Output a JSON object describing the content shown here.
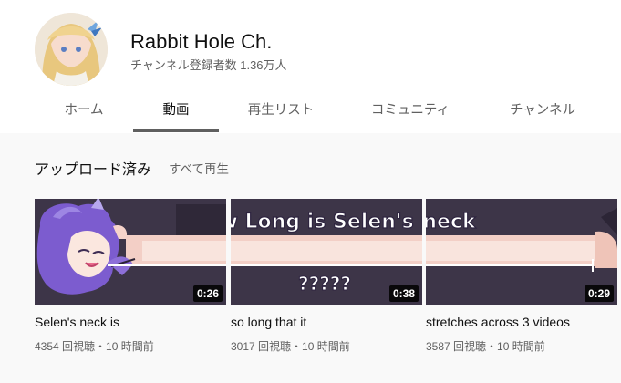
{
  "channel": {
    "name": "Rabbit Hole Ch.",
    "subscribers": "チャンネル登録者数 1.36万人"
  },
  "tabs": [
    {
      "label": "ホーム",
      "active": false
    },
    {
      "label": "動画",
      "active": true
    },
    {
      "label": "再生リスト",
      "active": false
    },
    {
      "label": "コミュニティ",
      "active": false
    },
    {
      "label": "チャンネル",
      "active": false
    }
  ],
  "shelf": {
    "title": "アップロード済み",
    "play_all": "すべて再生"
  },
  "thumbnail_text": {
    "headline": "How Long is Selen's neck",
    "question": "?????"
  },
  "videos": [
    {
      "title": "Selen's neck is",
      "duration": "0:26",
      "meta": "4354 回視聴・10 時間前"
    },
    {
      "title": "so long that it",
      "duration": "0:38",
      "meta": "3017 回視聴・10 時間前"
    },
    {
      "title": "stretches across 3 videos",
      "duration": "0:29",
      "meta": "3587 回視聴・10 時間前"
    }
  ],
  "colors": {
    "background": "#f9f9f9",
    "header_bg": "#ffffff",
    "text_primary": "#0f0f0f",
    "text_secondary": "#606060",
    "thumbnail_bg": "#3a3345",
    "neck_color": "#f7ddd6",
    "accent_purple": "#7c5ccf"
  }
}
